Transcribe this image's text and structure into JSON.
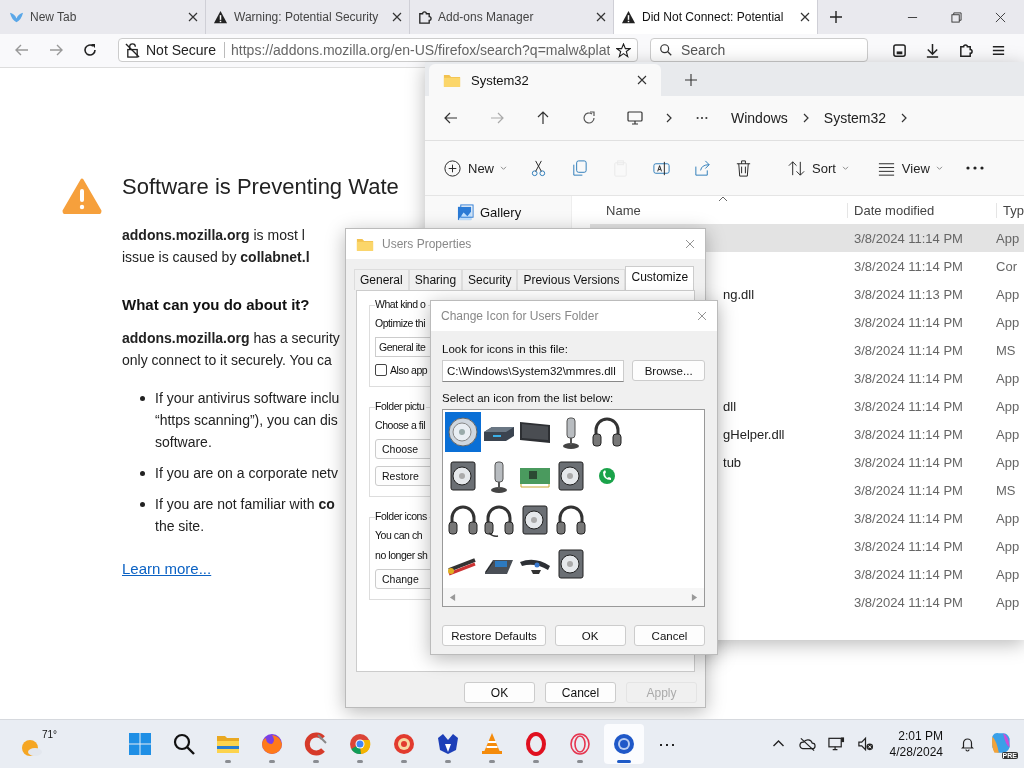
{
  "browser": {
    "tabs": [
      {
        "title": "New Tab",
        "kind": "bird",
        "selected": false
      },
      {
        "title": "Warning: Potential Security",
        "kind": "warning",
        "selected": false
      },
      {
        "title": "Add-ons Manager",
        "kind": "puzzle",
        "selected": false
      },
      {
        "title": "Did Not Connect: Potential",
        "kind": "warning",
        "selected": true
      }
    ],
    "security_label": "Not Secure",
    "url": "https://addons.mozilla.org/en-US/firefox/search?q=malw&plat",
    "search_placeholder": "Search"
  },
  "page": {
    "heading": "Software is Preventing Wate",
    "intro_lines": [
      "**addons.mozilla.org** is most l",
      "issue is caused by **collabnet.l**"
    ],
    "subheading": "What can you do about it?",
    "body_lines": [
      "**addons.mozilla.org** has a security",
      "only connect to it securely. You ca"
    ],
    "bullets": [
      [
        "If your antivirus software inclu",
        "“https scanning”), you can dis",
        "software."
      ],
      [
        "If you are on a corporate netv"
      ],
      [
        "If you are not familiar with **co**",
        "the site."
      ]
    ],
    "link": "Learn more..."
  },
  "explorer": {
    "tab": "System32",
    "breadcrumb": [
      "Windows",
      "System32"
    ],
    "toolbar": [
      {
        "kind": "new",
        "label": "New",
        "disabled": false
      },
      {
        "kind": "cut",
        "disabled": false
      },
      {
        "kind": "copy",
        "disabled": false
      },
      {
        "kind": "paste",
        "disabled": true
      },
      {
        "kind": "rename",
        "disabled": false
      },
      {
        "kind": "share",
        "disabled": false
      },
      {
        "kind": "delete",
        "disabled": false
      },
      {
        "kind": "sort",
        "label": "Sort",
        "disabled": false
      },
      {
        "kind": "view",
        "label": "View",
        "disabled": false
      },
      {
        "kind": "more",
        "disabled": false
      }
    ],
    "sidebar": [
      {
        "label": "Gallery"
      }
    ],
    "columns": [
      "Name",
      "Date modified",
      "Typ"
    ],
    "rows": [
      {
        "date": "3/8/2024 11:14 PM",
        "type": "App",
        "selected": true
      },
      {
        "date": "3/8/2024 11:14 PM",
        "type": "Cor",
        "selected": false
      },
      {
        "name": "ng.dll",
        "date": "3/8/2024 11:13 PM",
        "type": "App",
        "selected": false
      },
      {
        "date": "3/8/2024 11:14 PM",
        "type": "App",
        "selected": false
      },
      {
        "date": "3/8/2024 11:14 PM",
        "type": "MS",
        "selected": false
      },
      {
        "date": "3/8/2024 11:14 PM",
        "type": "App",
        "selected": false
      },
      {
        "name": "dll",
        "date": "3/8/2024 11:14 PM",
        "type": "App",
        "selected": false
      },
      {
        "name": "gHelper.dll",
        "date": "3/8/2024 11:14 PM",
        "type": "App",
        "selected": false
      },
      {
        "name": "tub",
        "date": "3/8/2024 11:14 PM",
        "type": "App",
        "selected": false
      },
      {
        "date": "3/8/2024 11:14 PM",
        "type": "MS",
        "selected": false
      },
      {
        "date": "3/8/2024 11:14 PM",
        "type": "App",
        "selected": false
      },
      {
        "date": "3/8/2024 11:14 PM",
        "type": "App",
        "selected": false
      },
      {
        "date": "3/8/2024 11:14 PM",
        "type": "App",
        "selected": false
      },
      {
        "date": "3/8/2024 11:14 PM",
        "type": "App",
        "selected": false
      }
    ]
  },
  "properties": {
    "title": "Users Properties",
    "tabs": [
      {
        "label": "General",
        "selected": false
      },
      {
        "label": "Sharing",
        "selected": false
      },
      {
        "label": "Security",
        "selected": false
      },
      {
        "label": "Previous Versions",
        "selected": false
      },
      {
        "label": "Customize",
        "selected": true
      }
    ],
    "groups": [
      {
        "legend": "What kind o",
        "lines": [
          "Optimize thi"
        ],
        "dropdown": "General ite",
        "checkbox": {
          "label": "Also app",
          "checked": false
        }
      },
      {
        "legend": "Folder pictu",
        "lines": [
          "Choose a fil"
        ],
        "buttons": [
          "Choose",
          "Restore"
        ]
      },
      {
        "legend": "Folder icons",
        "lines": [
          "You can ch",
          "no longer sh"
        ],
        "buttons": [
          "Change"
        ]
      }
    ],
    "buttons": [
      {
        "label": "OK",
        "disabled": false
      },
      {
        "label": "Cancel",
        "disabled": false
      },
      {
        "label": "Apply",
        "disabled": true
      }
    ]
  },
  "change_icon": {
    "title": "Change Icon for Users Folder",
    "file_label": "Look for icons in this file:",
    "file_value": "C:\\Windows\\System32\\mmres.dll",
    "browse": "Browse...",
    "list_label": "Select an icon from the list below:",
    "icon_rows": [
      [
        {
          "kind": "speaker",
          "selected": true
        },
        {
          "kind": "device",
          "selected": false
        },
        {
          "kind": "monitor",
          "selected": false
        },
        {
          "kind": "microphone",
          "selected": false
        },
        {
          "kind": "headphones",
          "selected": false
        }
      ],
      [
        {
          "kind": "speaker-box",
          "selected": false
        },
        {
          "kind": "microphone",
          "selected": false
        },
        {
          "kind": "circuit-board",
          "selected": false
        },
        {
          "kind": "speaker-box",
          "selected": false
        },
        {
          "kind": "phone",
          "selected": false
        }
      ],
      [
        {
          "kind": "headphones",
          "selected": false
        },
        {
          "kind": "headset",
          "selected": false
        },
        {
          "kind": "speaker-box",
          "selected": false
        },
        {
          "kind": "headphones",
          "selected": false
        }
      ],
      [
        {
          "kind": "cable",
          "selected": false
        },
        {
          "kind": "telephone",
          "selected": false
        },
        {
          "kind": "webcam",
          "selected": false
        },
        {
          "kind": "speaker-box",
          "selected": false
        }
      ]
    ],
    "buttons": [
      "Restore Defaults",
      "OK",
      "Cancel"
    ]
  },
  "taskbar": {
    "weather": "71°",
    "apps": [
      {
        "kind": "start",
        "running": false,
        "selected": false
      },
      {
        "kind": "search",
        "running": false,
        "selected": false
      },
      {
        "kind": "folder",
        "running": true,
        "selected": false
      },
      {
        "kind": "fox",
        "running": true,
        "selected": false
      },
      {
        "kind": "cleaner",
        "running": true,
        "selected": false
      },
      {
        "kind": "chrome",
        "running": true,
        "selected": false
      },
      {
        "kind": "red-disc",
        "running": true,
        "selected": false
      },
      {
        "kind": "shield",
        "running": true,
        "selected": false
      },
      {
        "kind": "cone",
        "running": true,
        "selected": false
      },
      {
        "kind": "ring",
        "running": true,
        "selected": false
      },
      {
        "kind": "pink-ring",
        "running": true,
        "selected": false
      },
      {
        "kind": "blue-disc",
        "running": true,
        "selected": true
      }
    ],
    "more": "⋯",
    "time": "2:01 PM",
    "date": "4/28/2024",
    "badge": "PRE"
  }
}
